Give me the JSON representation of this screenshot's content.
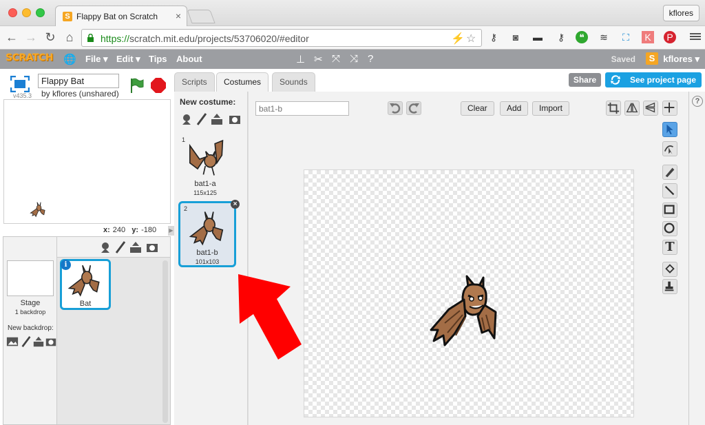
{
  "browser": {
    "tab_title": "Flappy Bat on Scratch",
    "tab_favicon": "S",
    "profile": "kflores",
    "url_scheme": "https://",
    "url_rest": "scratch.mit.edu/projects/53706020/#editor"
  },
  "scratch_bar": {
    "logo": "SCRATCH",
    "menus": [
      "File ▾",
      "Edit ▾",
      "Tips",
      "About"
    ],
    "saved": "Saved",
    "user_icon": "S",
    "user": "kflores ▾"
  },
  "project": {
    "title": "Flappy Bat",
    "byline": "by kflores (unshared)",
    "version": "v435.3"
  },
  "stage": {
    "x_label": "x:",
    "x_value": "240",
    "y_label": "y:",
    "y_value": "-180"
  },
  "sprites_panel": {
    "stage_label": "Stage",
    "backdrop_count": "1 backdrop",
    "new_backdrop": "New backdrop:",
    "sprite_name": "Bat",
    "info_badge": "i"
  },
  "tabs": [
    "Scripts",
    "Costumes",
    "Sounds"
  ],
  "header_buttons": {
    "share": "Share",
    "see_project": "See project page"
  },
  "costumes_panel": {
    "new_costume": "New costume:",
    "costumes": [
      {
        "number": "1",
        "name": "bat1-a",
        "size": "115x125"
      },
      {
        "number": "2",
        "name": "bat1-b",
        "size": "101x103"
      }
    ],
    "delete_glyph": "×"
  },
  "paint_editor": {
    "costume_name_placeholder": "bat1-b",
    "clear": "Clear",
    "add": "Add",
    "import": "Import",
    "help_glyph": "?",
    "text_tool_glyph": "T"
  },
  "colors": {
    "accent": "#1ba1e2",
    "scratch_bar": "#9c9ea2",
    "arrow": "#ff0000",
    "bat_fill": "#b0794f"
  }
}
